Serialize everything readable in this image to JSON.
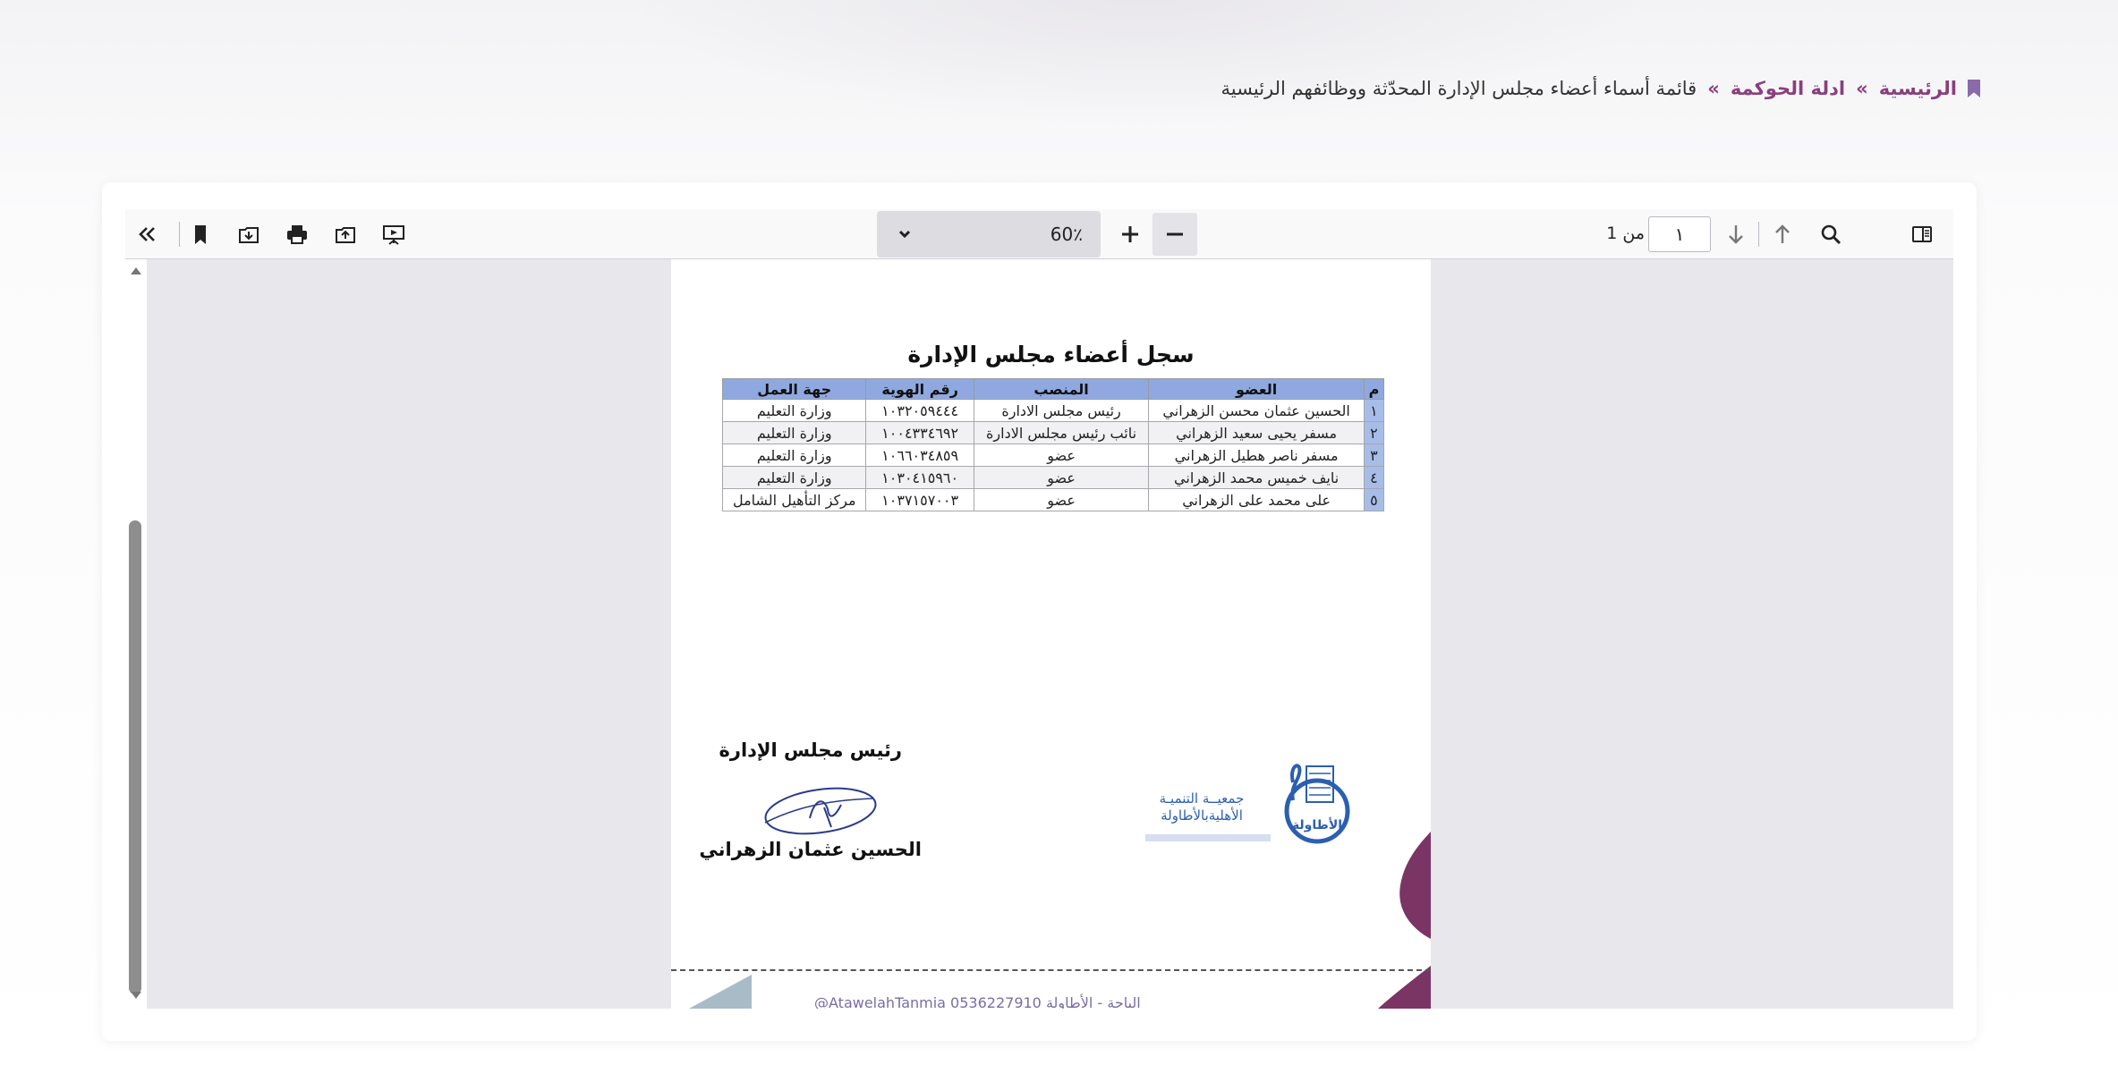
{
  "breadcrumb": {
    "home": "الرئيسية",
    "separator": "»",
    "section": "ادلة الحوكمة",
    "current": "قائمة أسماء أعضاء مجلس الإدارة المحدّثة ووظائفهم الرئيسية"
  },
  "toolbar": {
    "page_current": "١",
    "page_of": "من 1",
    "zoom": "60٪",
    "icons_left": [
      "collapse-sidebar-icon",
      "bookmark-icon",
      "save-icon",
      "print-icon",
      "open-file-icon",
      "presentation-icon"
    ],
    "icons_right": [
      "sidebar-toggle-icon",
      "search-icon",
      "previous-page-icon",
      "next-page-icon"
    ]
  },
  "document": {
    "title": "سجل أعضاء مجلس الإدارة",
    "table": {
      "headers": [
        "م",
        "العضو",
        "المنصب",
        "رقم الهوية",
        "جهة العمل"
      ],
      "rows": [
        [
          "١",
          "الحسين عثمان محسن الزهراني",
          "رئيس مجلس الادارة",
          "١٠٣٢٠٥٩٤٤٤",
          "وزارة التعليم"
        ],
        [
          "٢",
          "مسفر يحيى سعيد الزهراني",
          "نائب رئيس مجلس الادارة",
          "١٠٠٤٣٣٤٦٩٢",
          "وزارة التعليم"
        ],
        [
          "٣",
          "مسفر ناصر هطيل الزهراني",
          "عضو",
          "١٠٦٦٠٣٤٨٥٩",
          "وزارة التعليم"
        ],
        [
          "٤",
          "نايف خميس محمد الزهراني",
          "عضو",
          "١٠٣٠٤١٥٩٦٠",
          "وزارة التعليم"
        ],
        [
          "٥",
          "على محمد على الزهراني",
          "عضو",
          "١٠٣٧١٥٧٠٠٣",
          "مركز التأهيل الشامل"
        ]
      ]
    },
    "signature_title": "رئيس مجلس الإدارة",
    "signature_name": "الحسين عثمان الزهراني",
    "org_name_line1": "جمعيــة التنميـة",
    "org_name_line2": "الأهليةبالأطاولة",
    "footer": "@AtawelahTanmia  0536227910  الباحة - الأطاولة"
  }
}
